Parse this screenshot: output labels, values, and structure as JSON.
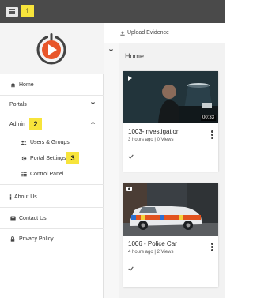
{
  "topbar": {
    "menu_icon": "hamburger-icon"
  },
  "badges": [
    "1",
    "2",
    "3"
  ],
  "sidebar": {
    "logo_icon": "brand-logo",
    "home": "Home",
    "portals": "Portals",
    "admin": "Admin",
    "admin_children": [
      "Users & Groups",
      "Portal Settings",
      "Control Panel"
    ],
    "about": "About Us",
    "contact": "Contact Us",
    "privacy": "Privacy Policy"
  },
  "main": {
    "upload_label": "Upload Evidence",
    "section_title": "Home",
    "cards": [
      {
        "title": "1003-Investigation",
        "meta": "3 hours ago | 0 Views",
        "duration": "00:33",
        "type": "video"
      },
      {
        "title": "1006 - Police Car",
        "meta": "4 hours ago | 2 Views",
        "type": "image"
      }
    ]
  },
  "colors": {
    "topbar": "#4a4a4a",
    "badge": "#f7e43b",
    "brand": "#e8562a"
  }
}
